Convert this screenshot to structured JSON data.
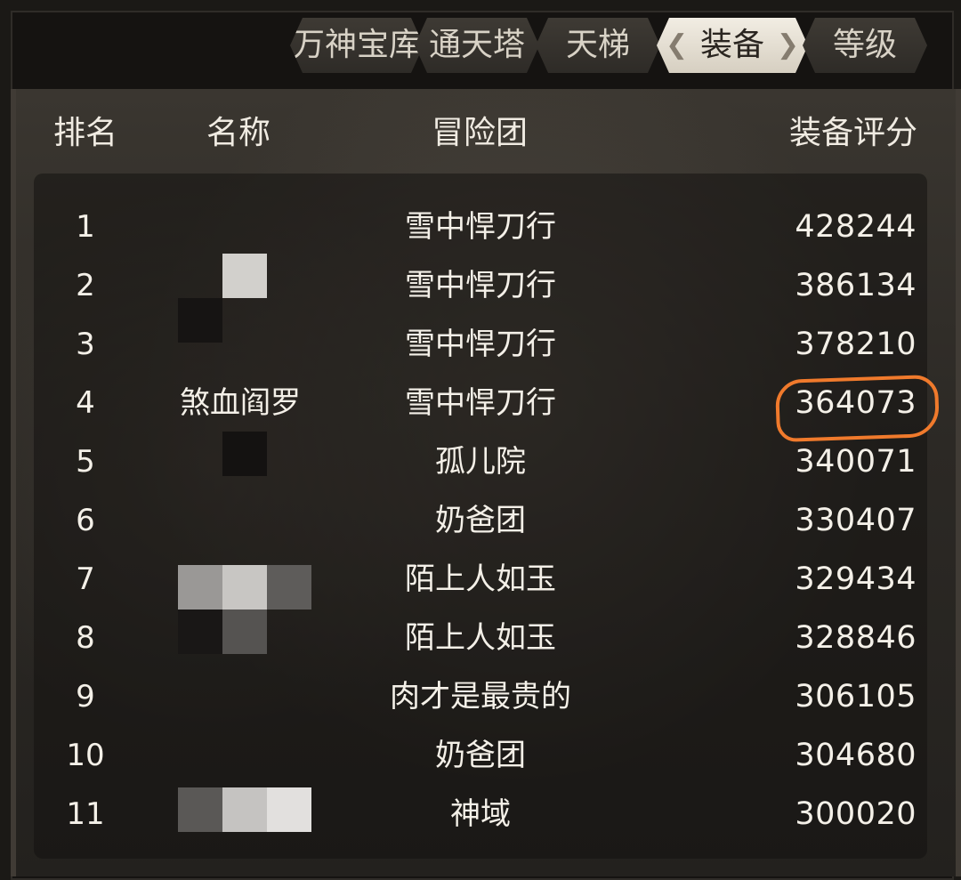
{
  "tabs": [
    {
      "label": "万神宝库",
      "active": false
    },
    {
      "label": "通天塔",
      "active": false
    },
    {
      "label": "天梯",
      "active": false
    },
    {
      "label": "装备",
      "active": true
    },
    {
      "label": "等级",
      "active": false
    }
  ],
  "header": {
    "rank": "排名",
    "name": "名称",
    "team": "冒险团",
    "score": "装备评分"
  },
  "rows": [
    {
      "rank": "1",
      "name": "",
      "team": "雪中悍刀行",
      "score": "428244"
    },
    {
      "rank": "2",
      "name": "",
      "team": "雪中悍刀行",
      "score": "386134"
    },
    {
      "rank": "3",
      "name": "",
      "team": "雪中悍刀行",
      "score": "378210"
    },
    {
      "rank": "4",
      "name": "煞血阎罗",
      "team": "雪中悍刀行",
      "score": "364073"
    },
    {
      "rank": "5",
      "name": "",
      "team": "孤儿院",
      "score": "340071"
    },
    {
      "rank": "6",
      "name": "",
      "team": "奶爸团",
      "score": "330407"
    },
    {
      "rank": "7",
      "name": "",
      "team": "陌上人如玉",
      "score": "329434"
    },
    {
      "rank": "8",
      "name": "",
      "team": "陌上人如玉",
      "score": "328846"
    },
    {
      "rank": "9",
      "name": "",
      "team": "肉才是最贵的",
      "score": "306105"
    },
    {
      "rank": "10",
      "name": "",
      "team": "奶爸团",
      "score": "304680"
    },
    {
      "rank": "11",
      "name": "",
      "team": "神域",
      "score": "300020"
    }
  ],
  "colors": {
    "highlight": "#f07a2c",
    "active_tab": "#efe9de"
  }
}
